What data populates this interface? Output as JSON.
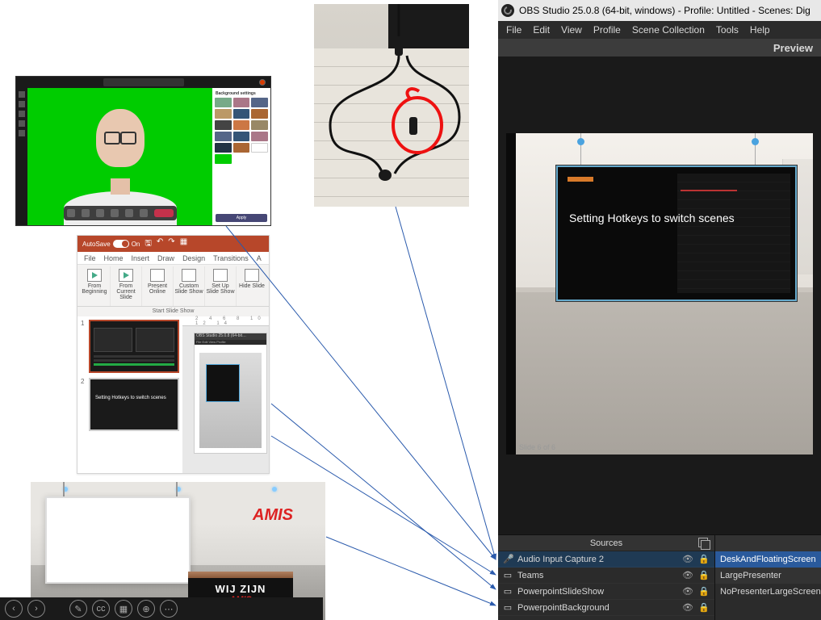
{
  "teams": {
    "panel_title": "Background settings",
    "apply": "Apply"
  },
  "ppt": {
    "autosave": "AutoSave",
    "toggle_state": "On",
    "tabs": {
      "file": "File",
      "home": "Home",
      "insert": "Insert",
      "draw": "Draw",
      "design": "Design",
      "transitions": "Transitions",
      "a": "A"
    },
    "ribbon": {
      "from_beginning": "From Beginning",
      "from_current": "From Current Slide",
      "present_online": "Present Online",
      "custom": "Custom Slide Show",
      "setup": "Set Up Slide Show",
      "hide": "Hide Slide",
      "group": "Start Slide Show"
    },
    "ruler": "2 4 6 8 10 12 14",
    "slide2_text": "Setting Hotkeys to switch scenes",
    "mini_title": "OBS Studio 25.0.8 (64-bit…",
    "mini_menu": "File  Edit  View  Profile"
  },
  "vset": {
    "logo": "AMIS",
    "podium1": "WIJ ZIJN",
    "podium2": "AMIS"
  },
  "obs": {
    "title": "OBS Studio 25.0.8 (64-bit, windows) - Profile: Untitled - Scenes: Dig",
    "menu": {
      "file": "File",
      "edit": "Edit",
      "view": "View",
      "profile": "Profile",
      "scene_collection": "Scene Collection",
      "tools": "Tools",
      "help": "Help"
    },
    "preview": "Preview",
    "slide_text": "Setting Hotkeys to switch scenes",
    "slide_num": "Slide 6 of 6",
    "sources_header": "Sources",
    "sources": [
      {
        "icon": "mic",
        "label": "Audio Input Capture 2",
        "selected": true
      },
      {
        "icon": "win",
        "label": "Teams",
        "selected": false
      },
      {
        "icon": "win",
        "label": "PowerpointSlideShow",
        "selected": false
      },
      {
        "icon": "win",
        "label": "PowerpointBackground",
        "selected": false
      }
    ],
    "scenes": [
      {
        "label": "DeskAndFloatingScreen",
        "selected": true
      },
      {
        "label": "LargePresenter",
        "selected": false
      },
      {
        "label": "NoPresenterLargeScreen",
        "selected": false
      }
    ]
  }
}
